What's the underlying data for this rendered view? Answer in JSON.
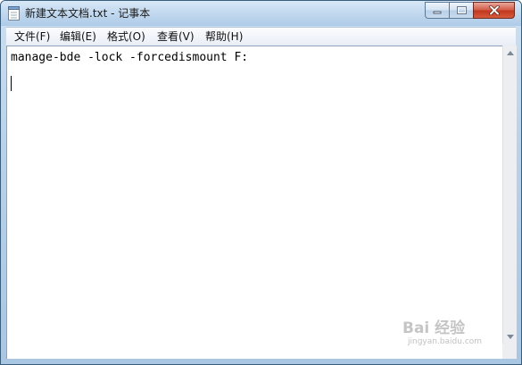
{
  "window": {
    "title": "新建文本文档.txt - 记事本"
  },
  "menu": {
    "items": [
      {
        "label": "文件(F)"
      },
      {
        "label": "编辑(E)"
      },
      {
        "label": "格式(O)"
      },
      {
        "label": "查看(V)"
      },
      {
        "label": "帮助(H)"
      }
    ]
  },
  "editor": {
    "content": "manage-bde -lock -forcedismount F:"
  },
  "watermark": {
    "logo": "Bai 经验",
    "url": "jingyan.baidu.com"
  },
  "icons": {
    "app": "notepad-icon",
    "minimize": "minimize-icon",
    "maximize": "maximize-icon",
    "close": "close-icon",
    "scroll_up": "scroll-up-arrow-icon",
    "scroll_down": "scroll-down-arrow-icon"
  },
  "colors": {
    "close_button": "#c2381f",
    "titlebar": "#c2d8ee"
  }
}
